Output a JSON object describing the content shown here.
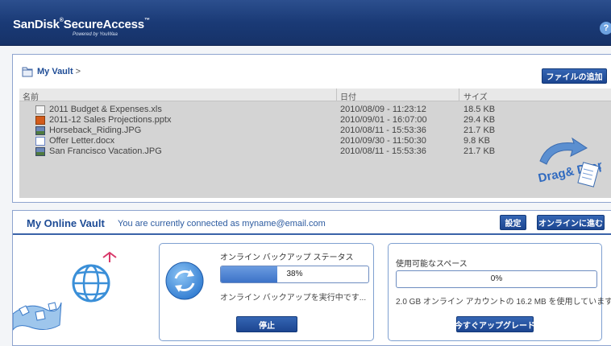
{
  "header": {
    "brand": "SanDisk",
    "brand_reg": "®",
    "product": "SecureAccess",
    "product_tm": "™",
    "powered_by": "Powered by YouWaa",
    "help": "?"
  },
  "vault": {
    "breadcrumb": "My Vault",
    "breadcrumb_sep": ">",
    "add_file_label": "ファイルの追加",
    "columns": {
      "name": "名前",
      "date": "日付",
      "size": "サイズ"
    },
    "files": [
      {
        "icon": "xls-file-icon",
        "name": "2011 Budget & Expenses.xls",
        "date": "2010/08/09 - 11:23:12",
        "size": "18.5 KB"
      },
      {
        "icon": "pptx-file-icon",
        "name": "2011-12 Sales Projections.pptx",
        "date": "2010/09/01 - 16:07:00",
        "size": "29.4 KB"
      },
      {
        "icon": "jpg-image-icon",
        "name": "Horseback_Riding.JPG",
        "date": "2010/08/11 - 15:53:36",
        "size": "21.7 KB"
      },
      {
        "icon": "docx-file-icon",
        "name": "Offer Letter.docx",
        "date": "2010/09/30 - 11:50:30",
        "size": "9.8 KB"
      },
      {
        "icon": "jpg-image-icon",
        "name": "San Francisco Vacation.JPG",
        "date": "2010/08/11 - 15:53:36",
        "size": "21.7 KB"
      }
    ],
    "drag_drop_label": "Drag& Drop"
  },
  "online": {
    "title": "My Online Vault",
    "status": "You are currently connected as myname@email.com",
    "settings_label": "設定",
    "go_online_label": "オンラインに進む",
    "backup": {
      "title": "オンライン バックアップ ステータス",
      "progress": 0.38,
      "progress_text": "38%",
      "message": "オンライン バックアップを実行中です...",
      "stop_label": "停止"
    },
    "space": {
      "title": "使用可能なスペース",
      "usage": 0.0,
      "usage_text": "0%",
      "message": "2.0 GB オンライン アカウントの 16.2 MB を使用しています",
      "upgrade_label": "今すぐアップグレード"
    }
  },
  "colors": {
    "header": "#1a3a76",
    "accent": "#1e4c96",
    "progress": "#3d73c8"
  }
}
